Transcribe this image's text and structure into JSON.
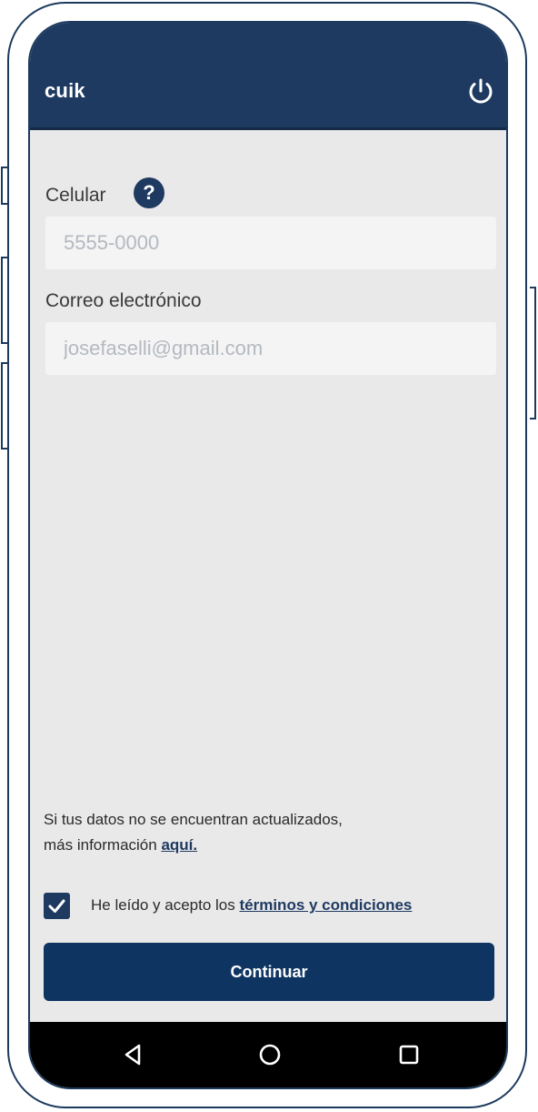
{
  "app": {
    "title": "cuik"
  },
  "form": {
    "phone": {
      "label": "Celular",
      "placeholder": "5555-0000",
      "value": ""
    },
    "email": {
      "label": "Correo electrónico",
      "placeholder": "josefaselli@gmail.com",
      "value": ""
    }
  },
  "info": {
    "line1": "Si tus datos no se encuentran actualizados,",
    "line2_prefix": "más información ",
    "link": "aquí."
  },
  "terms": {
    "checked": true,
    "prefix": "He leído y acepto los ",
    "link": "términos y condiciones"
  },
  "actions": {
    "continue_label": "Continuar"
  },
  "icons": {
    "power": "power-icon",
    "help": "help-icon",
    "check": "check-icon",
    "nav_back": "back-triangle-icon",
    "nav_home": "home-circle-icon",
    "nav_recents": "recents-square-icon"
  },
  "colors": {
    "primary": "#1f3a61",
    "button": "#0e3461",
    "background": "#e9e9e9",
    "input_bg": "#f4f4f4"
  }
}
